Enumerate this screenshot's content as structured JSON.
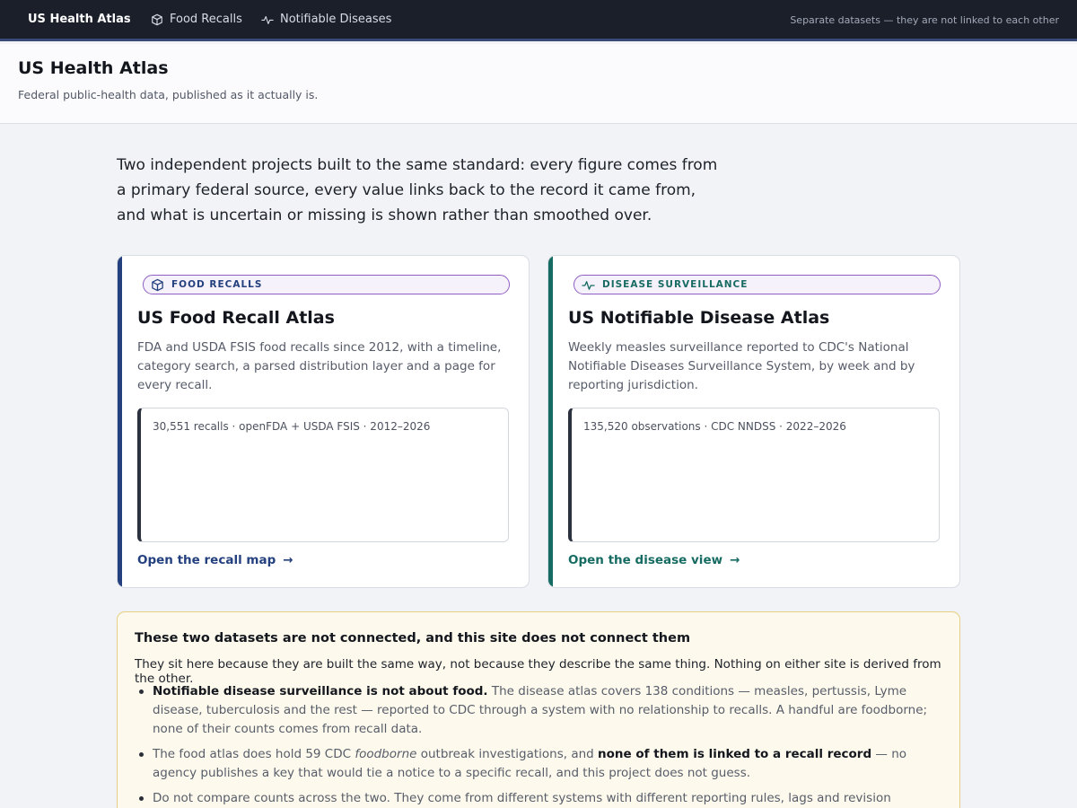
{
  "nav": {
    "brand": "US Health Atlas",
    "food_recalls": "Food Recalls",
    "notifiable_diseases": "Notifiable Diseases",
    "note": "Separate datasets — they are not linked to each other"
  },
  "header": {
    "title": "US Health Atlas",
    "subtitle": "Federal public-health data, published as it actually is."
  },
  "intro": "Two independent projects built to the same standard: every figure comes from a primary federal source, every value links back to the record it came from, and what is uncertain or missing is shown rather than smoothed over.",
  "cards": {
    "food": {
      "tag": "FOOD RECALLS",
      "title": "US Food Recall Atlas",
      "description": "FDA and USDA FSIS food recalls since 2012, with a timeline, category search, a parsed distribution layer and a page for every recall.",
      "stats": "30,551 recalls · openFDA + USDA FSIS · 2012–2026",
      "link": "Open the recall map",
      "accent": "#24407e"
    },
    "disease": {
      "tag": "DISEASE SURVEILLANCE",
      "title": "US Notifiable Disease Atlas",
      "description": "Weekly measles surveillance reported to CDC's National Notifiable Diseases Surveillance System, by week and by reporting jurisdiction.",
      "stats": "135,520 observations · CDC NNDSS · 2022–2026",
      "link": "Open the disease view",
      "accent": "#166b62"
    }
  },
  "notice": {
    "title": "These two datasets are not connected, and this site does not connect them",
    "lead": "They sit here because they are built the same way, not because they describe the same thing. Nothing on either site is derived from the other.",
    "items": [
      {
        "bold": "Notifiable disease surveillance is not about food.",
        "text": " The disease atlas covers 138 conditions — measles, pertussis, Lyme disease, tuberculosis and the rest — reported to CDC through a system with no relationship to recalls. A handful are foodborne; none of their counts comes from recall data."
      },
      {
        "pre": "The food atlas does hold 59 CDC ",
        "em": "foodborne",
        "mid": " outbreak investigations, and ",
        "bold": "none of them is linked to a recall record",
        "post": " — no agency publishes a key that would tie a notice to a specific recall, and this project does not guess."
      },
      {
        "text": "Do not compare counts across the two. They come from different systems with different reporting rules, lags and revision behaviour."
      }
    ]
  }
}
